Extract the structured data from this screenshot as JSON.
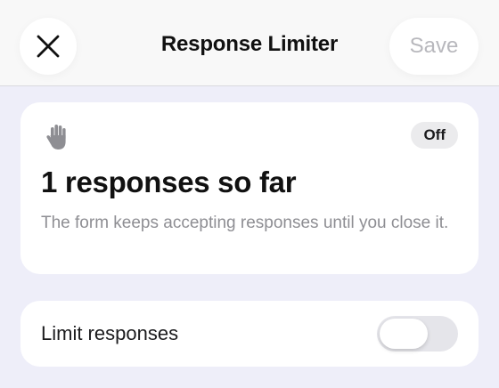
{
  "header": {
    "title": "Response Limiter",
    "close_icon": "close-icon",
    "save_label": "Save"
  },
  "status_card": {
    "icon": "hand-raised-icon",
    "badge": "Off",
    "count_text": "1 responses so far",
    "description": "The form keeps accepting responses until you close it."
  },
  "limit_card": {
    "label": "Limit responses",
    "toggle_on": false
  },
  "colors": {
    "background": "#eeeef9",
    "header": "#f8f8f8",
    "disabled_text": "#b8b8bd",
    "secondary_text": "#8e8e93",
    "toggle_off": "#e5e5ea"
  }
}
